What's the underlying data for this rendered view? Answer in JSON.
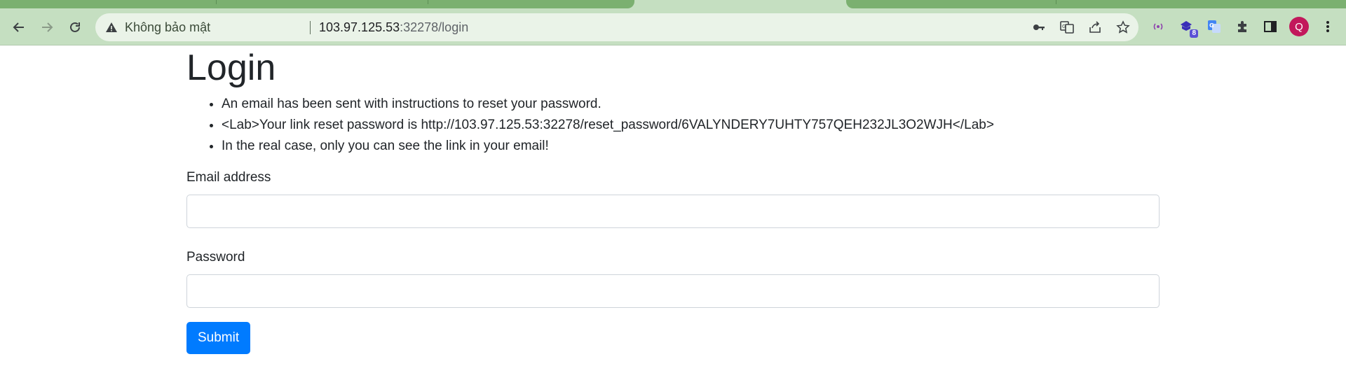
{
  "browser": {
    "address_bar": {
      "security_label": "Không bảo mật",
      "url_host": "103.97.125.53",
      "url_rest": ":32278/login"
    },
    "extensions": {
      "badge_count": "8"
    },
    "profile_initial": "Q",
    "colors": {
      "chrome": "#c5dfc1",
      "tab": "#7bb070",
      "omnibox": "#eaf3e8",
      "avatar": "#c2185b"
    },
    "icons": [
      "back-icon",
      "forward-icon",
      "reload-icon",
      "warning-icon",
      "key-icon",
      "translate-icon",
      "share-icon",
      "star-icon",
      "broadcast-icon",
      "extension-icon",
      "google-translate-icon",
      "puzzle-icon",
      "sidepanel-icon",
      "menu-icon"
    ]
  },
  "page": {
    "title": "Login",
    "messages": [
      "An email has been sent with instructions to reset your password.",
      "<Lab>Your link reset password is http://103.97.125.53:32278/reset_password/6VALYNDERY7UHTY757QEH232JL3O2WJH</Lab>",
      "In the real case, only you can see the link in your email!"
    ],
    "form": {
      "email_label": "Email address",
      "email_value": "",
      "password_label": "Password",
      "password_value": "",
      "submit_label": "Submit"
    },
    "colors": {
      "primary_button": "#007bff",
      "text": "#212529"
    }
  }
}
